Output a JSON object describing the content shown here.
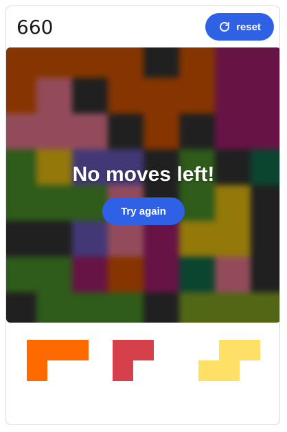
{
  "header": {
    "score": "660",
    "reset_label": "reset",
    "reset_icon": "refresh-icon"
  },
  "board": {
    "rows": 8,
    "cols": 8,
    "cells": [
      [
        "#b34700",
        "#b34700",
        "#b34700",
        "#b34700",
        "#2b2b2b",
        "#b34700",
        "#8a1a5c",
        "#8a1a5c"
      ],
      [
        "#b34700",
        "#c4657a",
        "#2b2b2b",
        "#b34700",
        "#b34700",
        "#b34700",
        "#8a1a5c",
        "#8a1a5c"
      ],
      [
        "#c4657a",
        "#c4657a",
        "#c4657a",
        "#2b2b2b",
        "#b34700",
        "#2b2b2b",
        "#8a1a5c",
        "#8a1a5c"
      ],
      [
        "#3f7a24",
        "#c4a10e",
        "#5a4b9e",
        "#5a4b9e",
        "#2b2b2b",
        "#3f7a24",
        "#2b2b2b",
        "#0f5c40"
      ],
      [
        "#3f7a24",
        "#3f7a24",
        "#3f7a24",
        "#c4657a",
        "#2b2b2b",
        "#3f7a24",
        "#c4a10e",
        "#2b2b2b"
      ],
      [
        "#2b2b2b",
        "#2b2b2b",
        "#5a4b9e",
        "#c4657a",
        "#8a1a5c",
        "#c4a10e",
        "#c4a10e",
        "#2b2b2b"
      ],
      [
        "#3f7a24",
        "#3f7a24",
        "#8a1a5c",
        "#b34700",
        "#8a1a5c",
        "#0f5c40",
        "#c4657a",
        "#2b2b2b"
      ],
      [
        "#2b2b2b",
        "#3f7a24",
        "#3f7a24",
        "#3f7a24",
        "#2b2b2b",
        "#6e8a1e",
        "#6e8a1e",
        "#6e8a1e"
      ]
    ]
  },
  "game_over": {
    "title": "No moves left!",
    "try_again_label": "Try again"
  },
  "tray": {
    "pieces": [
      {
        "name": "orange-piece",
        "color": "#ff6a00",
        "shape": [
          [
            1,
            1,
            1
          ],
          [
            1,
            0,
            0
          ]
        ]
      },
      {
        "name": "red-piece",
        "color": "#d6404a",
        "shape": [
          [
            1,
            1
          ],
          [
            1,
            0
          ]
        ]
      },
      {
        "name": "yellow-piece",
        "color": "#ffe066",
        "shape": [
          [
            0,
            1,
            1
          ],
          [
            1,
            1,
            0
          ]
        ]
      }
    ]
  }
}
